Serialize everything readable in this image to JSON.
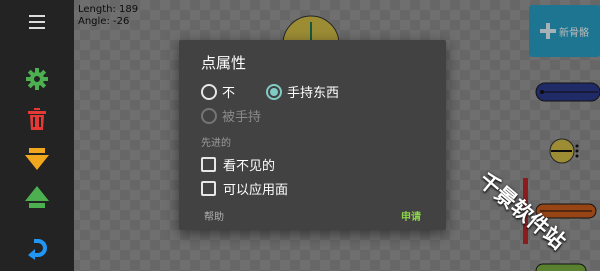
{
  "readout": {
    "length": "Length: 189",
    "angle": "Angle: -26"
  },
  "toolbar": {
    "items": [
      {
        "icon": "menu-icon",
        "color": "#dcdcdc"
      },
      {
        "icon": "gear-icon",
        "color": "#4caf50"
      },
      {
        "icon": "trash-icon",
        "color": "#e53935"
      },
      {
        "icon": "arrow-down-icon",
        "color": "#f2a81d"
      },
      {
        "icon": "arrow-up-icon",
        "color": "#4caf50"
      },
      {
        "icon": "undo-icon",
        "color": "#2196f3"
      }
    ]
  },
  "new_bone": {
    "label": "新骨骼",
    "icon": "plus-icon",
    "color": "#2aa3c9"
  },
  "dialog": {
    "title": "点属性",
    "options": {
      "none": "不",
      "holding": "手持东西",
      "held": "被手持"
    },
    "selected": "holding",
    "section_label": "先进的",
    "checkboxes": {
      "invisible": "看不见的",
      "apply_face": "可以应用面"
    },
    "help_label": "帮助",
    "apply_label": "申请"
  },
  "watermark": "千景软件站",
  "colors": {
    "accent": "#80cbc4",
    "apply": "#8bd44a",
    "dialog_bg": "#424242"
  }
}
